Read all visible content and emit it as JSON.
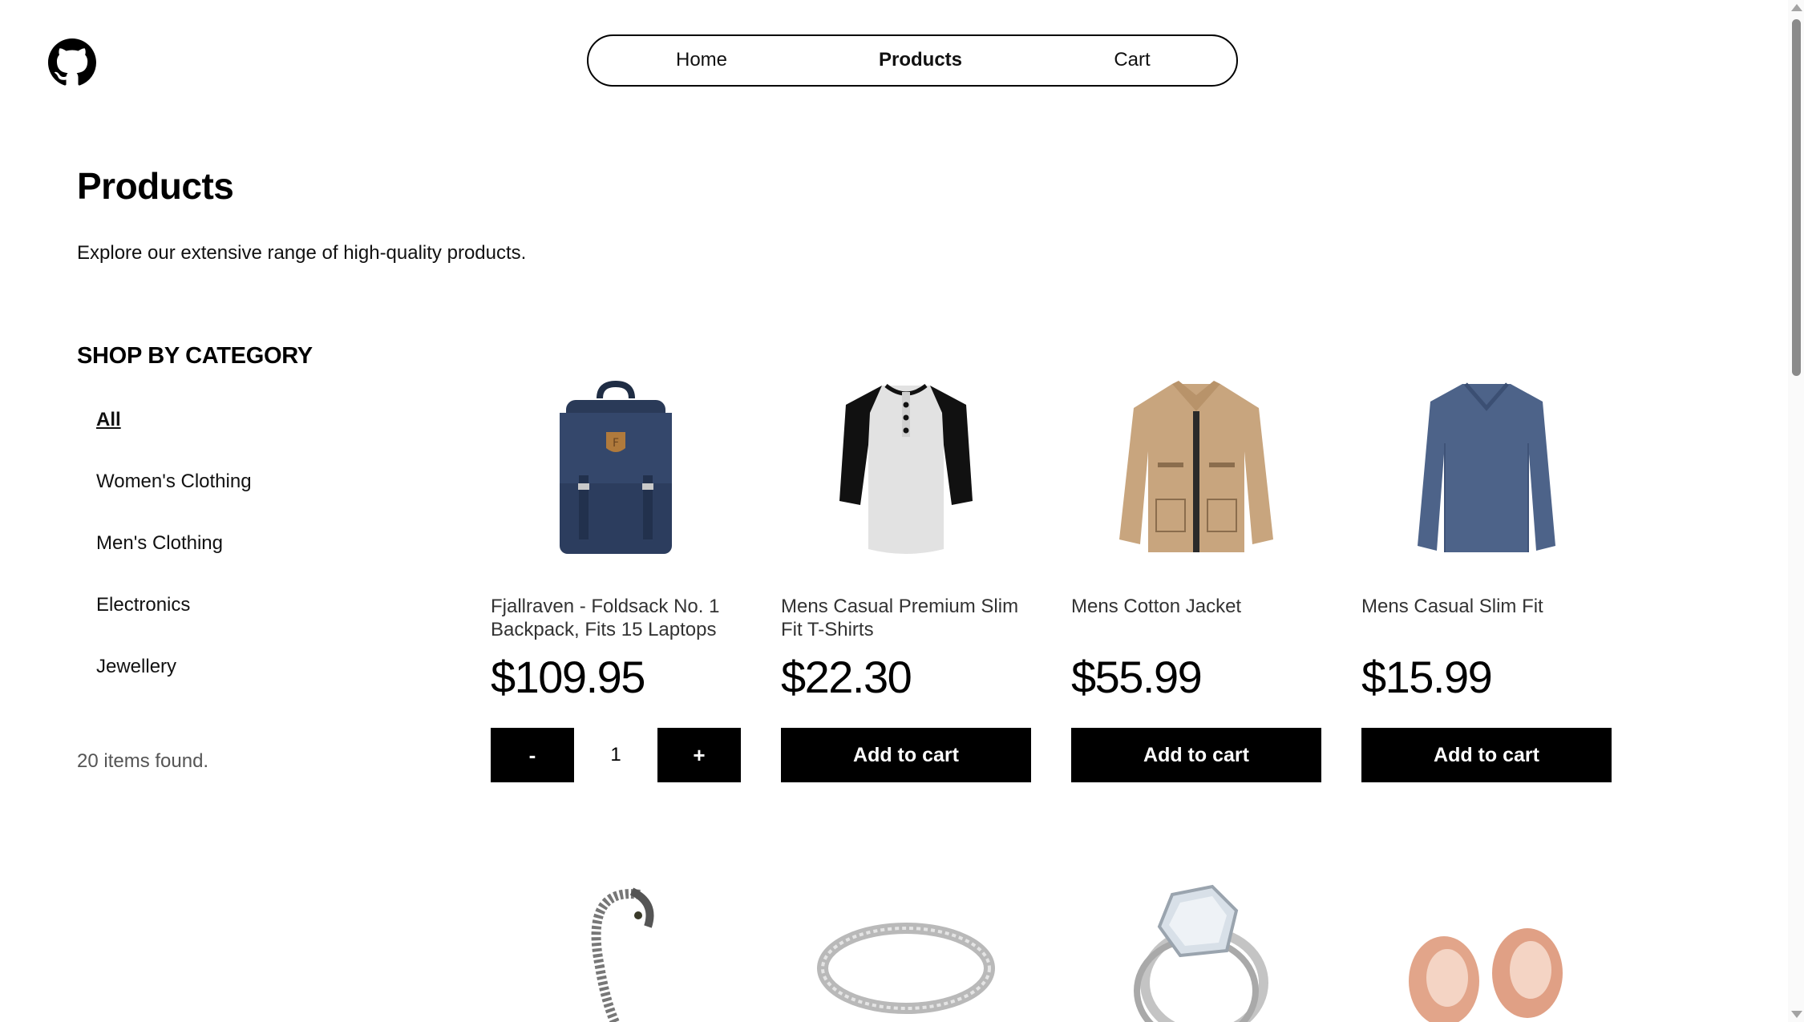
{
  "nav": {
    "items": [
      {
        "label": "Home",
        "active": false
      },
      {
        "label": "Products",
        "active": true
      },
      {
        "label": "Cart",
        "active": false
      }
    ],
    "logo_icon": "github-icon"
  },
  "page": {
    "title": "Products",
    "subtitle": "Explore our extensive range of high-quality products."
  },
  "categories": {
    "heading": "SHOP BY CATEGORY",
    "items": [
      {
        "label": "All",
        "active": true
      },
      {
        "label": "Women's Clothing",
        "active": false
      },
      {
        "label": "Men's Clothing",
        "active": false
      },
      {
        "label": "Electronics",
        "active": false
      },
      {
        "label": "Jewellery",
        "active": false
      }
    ],
    "items_found": "20 items found."
  },
  "products": [
    {
      "name": "Fjallraven - Foldsack No. 1 Backpack, Fits 15 Laptops",
      "price": "$109.95",
      "image_icon": "backpack-image",
      "in_cart": true,
      "quantity": "1",
      "minus_label": "-",
      "plus_label": "+"
    },
    {
      "name": "Mens Casual Premium Slim Fit T-Shirts",
      "price": "$22.30",
      "image_icon": "tshirt-image",
      "in_cart": false,
      "button_label": "Add to cart"
    },
    {
      "name": "Mens Cotton Jacket",
      "price": "$55.99",
      "image_icon": "jacket-image",
      "in_cart": false,
      "button_label": "Add to cart"
    },
    {
      "name": "Mens Casual Slim Fit",
      "price": "$15.99",
      "image_icon": "longsleeve-image",
      "in_cart": false,
      "button_label": "Add to cart"
    }
  ],
  "products_row2": [
    {
      "image_icon": "bracelet-image"
    },
    {
      "image_icon": "silver-ring-image"
    },
    {
      "image_icon": "diamond-ring-image"
    },
    {
      "image_icon": "rose-gold-plugs-image"
    }
  ],
  "colors": {
    "accent": "#000000",
    "background": "#ffffff",
    "muted_text": "#555555"
  }
}
